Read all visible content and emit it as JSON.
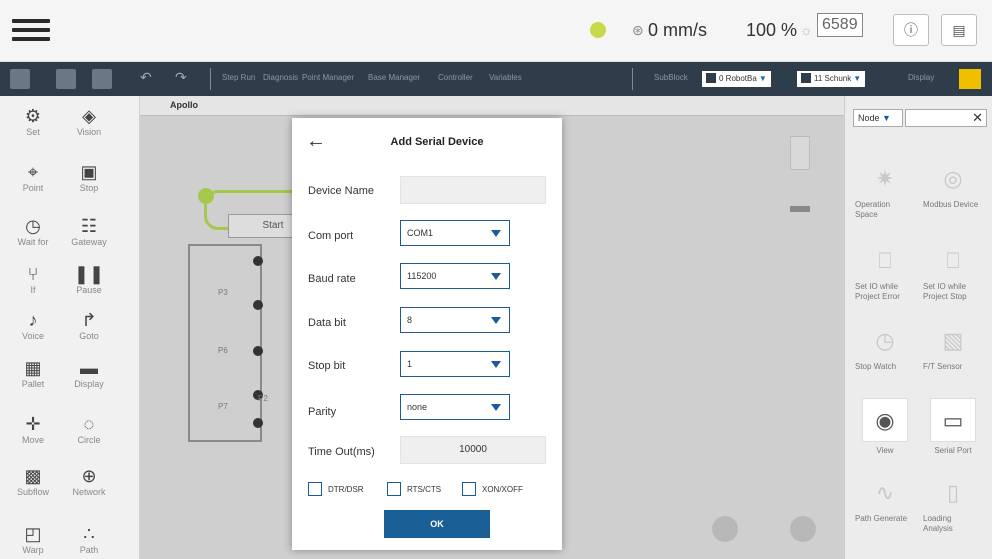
{
  "topbar": {
    "speed": "0 mm/s",
    "percent": "100 %",
    "count": "6589"
  },
  "toolbar": {
    "links": [
      "Step Run",
      "Diagnosis",
      "Point Manager",
      "Base Manager",
      "Controller",
      "Variables"
    ],
    "link_right": "SubBlock",
    "robot_select": "0 RobotBa",
    "tool_select": "11 Schunk",
    "display_label": "Display"
  },
  "sidebar": {
    "items": [
      {
        "label": "Set",
        "icon": "set-icon",
        "glyph": "⚙"
      },
      {
        "label": "Vision",
        "icon": "vision-icon",
        "glyph": "◈"
      },
      {
        "label": "Point",
        "icon": "point-icon",
        "glyph": "⌖"
      },
      {
        "label": "Stop",
        "icon": "stop-icon",
        "glyph": "▣"
      },
      {
        "label": "Wait for",
        "icon": "wait-for-icon",
        "glyph": "◷"
      },
      {
        "label": "Gateway",
        "icon": "gateway-icon",
        "glyph": "☷"
      },
      {
        "label": "If",
        "icon": "if-icon",
        "glyph": "⑂"
      },
      {
        "label": "Pause",
        "icon": "pause-icon",
        "glyph": "❚❚"
      },
      {
        "label": "Voice",
        "icon": "voice-icon",
        "glyph": "♪"
      },
      {
        "label": "Goto",
        "icon": "goto-icon",
        "glyph": "↱"
      },
      {
        "label": "Pallet",
        "icon": "pallet-icon",
        "glyph": "▦"
      },
      {
        "label": "Display",
        "icon": "display-icon",
        "glyph": "▬"
      },
      {
        "label": "Move",
        "icon": "move-icon",
        "glyph": "✛"
      },
      {
        "label": "Circle",
        "icon": "circle-icon",
        "glyph": "◌"
      },
      {
        "label": "Subflow",
        "icon": "subflow-icon",
        "glyph": "▩"
      },
      {
        "label": "Network",
        "icon": "network-icon",
        "glyph": "⊕"
      },
      {
        "label": "Warp",
        "icon": "warp-icon",
        "glyph": "◰"
      },
      {
        "label": "Path",
        "icon": "path-icon",
        "glyph": "∴"
      }
    ]
  },
  "canvas": {
    "tab_title": "Apollo",
    "start_label": "Start",
    "node_labels": [
      "P3",
      "P6",
      "P7",
      "P2"
    ]
  },
  "right_panel": {
    "select_value": "Node",
    "items": [
      {
        "label": "Operation Space",
        "icon": "operation-space-icon",
        "glyph": "✷"
      },
      {
        "label": "Modbus Device",
        "icon": "modbus-device-icon",
        "glyph": "◎"
      },
      {
        "label": "Set IO while Project Error",
        "icon": "io-error-icon",
        "glyph": "⎕"
      },
      {
        "label": "Set IO while Project Stop",
        "icon": "io-stop-icon",
        "glyph": "⎕"
      },
      {
        "label": "Stop Watch",
        "icon": "stopwatch-icon",
        "glyph": "◷"
      },
      {
        "label": "F/T Sensor",
        "icon": "ft-sensor-icon",
        "glyph": "▧"
      },
      {
        "label": "View",
        "icon": "view-icon",
        "glyph": "◉"
      },
      {
        "label": "Serial Port",
        "icon": "serial-port-icon",
        "glyph": "▭"
      },
      {
        "label": "Path Generate",
        "icon": "path-generate-icon",
        "glyph": "∿"
      },
      {
        "label": "Loading Analysis",
        "icon": "loading-analysis-icon",
        "glyph": "▯"
      }
    ]
  },
  "dialog": {
    "title": "Add Serial Device",
    "device_name_label": "Device Name",
    "device_name_value": "",
    "com_port_label": "Com port",
    "com_port_value": "COM1",
    "baud_rate_label": "Baud rate",
    "baud_rate_value": "115200",
    "data_bit_label": "Data bit",
    "data_bit_value": "8",
    "stop_bit_label": "Stop bit",
    "stop_bit_value": "1",
    "parity_label": "Parity",
    "parity_value": "none",
    "timeout_label": "Time Out(ms)",
    "timeout_value": "10000",
    "cb_dtr": "DTR/DSR",
    "cb_rts": "RTS/CTS",
    "cb_xon": "XON/XOFF",
    "ok_label": "OK"
  },
  "colors": {
    "accent_blue": "#1a5e96",
    "toolbar_bg": "#2f3d4a",
    "flow_green": "#a4c84c"
  }
}
